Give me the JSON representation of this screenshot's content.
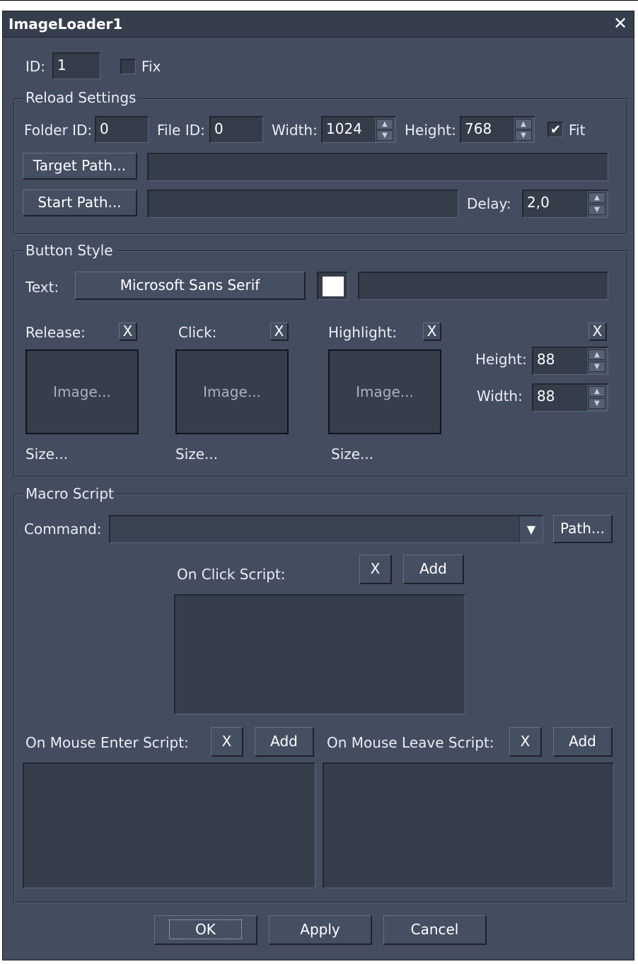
{
  "window": {
    "title": "ImageLoader1",
    "close_icon": "close-icon"
  },
  "id_row": {
    "id_label": "ID:",
    "id_value": "1",
    "fix_label": "Fix",
    "fix_checked": false
  },
  "reload": {
    "legend": "Reload Settings",
    "folder_id_label": "Folder ID:",
    "folder_id_value": "0",
    "file_id_label": "File ID:",
    "file_id_value": "0",
    "width_label": "Width:",
    "width_value": "1024",
    "height_label": "Height:",
    "height_value": "768",
    "fit_label": "Fit",
    "fit_checked": true,
    "target_path_button": "Target Path...",
    "target_path_value": "",
    "start_path_button": "Start Path...",
    "start_path_value": "",
    "delay_label": "Delay:",
    "delay_value": "2,0"
  },
  "button_style": {
    "legend": "Button Style",
    "text_label": "Text:",
    "font_button": "Microsoft Sans Serif",
    "color_swatch": "#ffffff",
    "text_value": "",
    "release_label": "Release:",
    "click_label": "Click:",
    "highlight_label": "Highlight:",
    "clear_symbol": "X",
    "image_placeholder": "Image...",
    "size_label": "Size...",
    "height_label": "Height:",
    "height_value": "88",
    "width_label": "Width:",
    "width_value": "88"
  },
  "macro": {
    "legend": "Macro Script",
    "command_label": "Command:",
    "command_value": "",
    "path_button": "Path...",
    "on_click_label": "On Click Script:",
    "on_enter_label": "On Mouse Enter Script:",
    "on_leave_label": "On Mouse Leave Script:",
    "clear_symbol": "X",
    "add_label": "Add"
  },
  "footer": {
    "ok": "OK",
    "apply": "Apply",
    "cancel": "Cancel"
  }
}
